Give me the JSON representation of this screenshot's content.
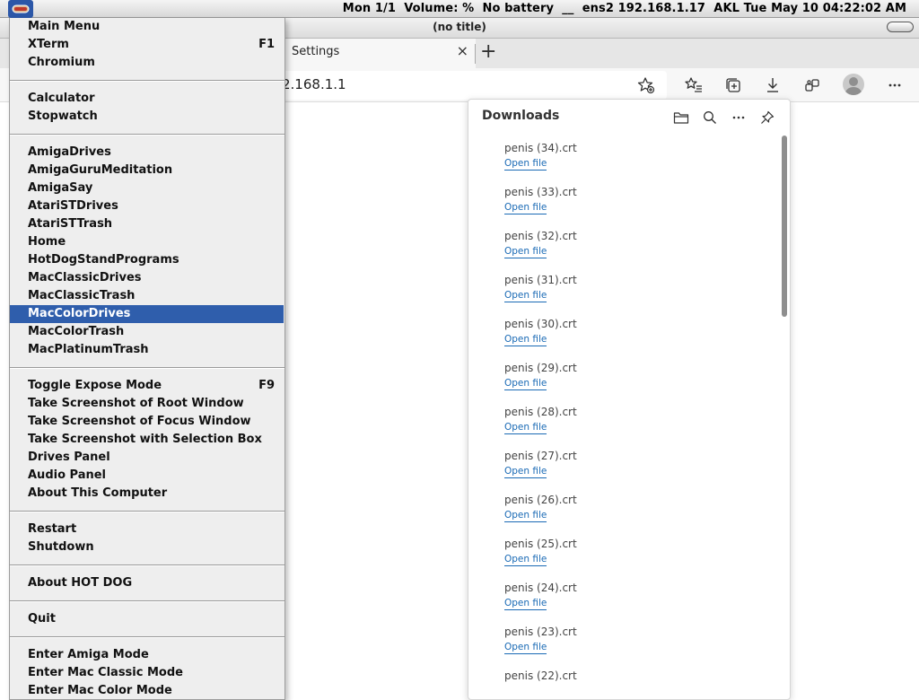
{
  "topbar": {
    "status": "Mon 1/1  Volume: %  No battery  __  ens2 192.168.1.17  AKL Tue May 10 04:22:02 AM"
  },
  "window": {
    "title": "(no title)"
  },
  "browser": {
    "tab": {
      "label": "Settings",
      "close": "×"
    },
    "new_tab": "+",
    "address": "2.168.1.1"
  },
  "downloads": {
    "title": "Downloads",
    "open_label": "Open file",
    "items": [
      {
        "name": "penis (34).crt",
        "action": "Open file"
      },
      {
        "name": "penis (33).crt",
        "action": "Open file"
      },
      {
        "name": "penis (32).crt",
        "action": "Open file"
      },
      {
        "name": "penis (31).crt",
        "action": "Open file"
      },
      {
        "name": "penis (30).crt",
        "action": "Open file"
      },
      {
        "name": "penis (29).crt",
        "action": "Open file"
      },
      {
        "name": "penis (28).crt",
        "action": "Open file"
      },
      {
        "name": "penis (27).crt",
        "action": "Open file"
      },
      {
        "name": "penis (26).crt",
        "action": "Open file"
      },
      {
        "name": "penis (25).crt",
        "action": "Open file"
      },
      {
        "name": "penis (24).crt",
        "action": "Open file"
      },
      {
        "name": "penis (23).crt",
        "action": "Open file"
      },
      {
        "name": "penis (22).crt",
        "action": ""
      }
    ]
  },
  "menu": {
    "groups": [
      [
        {
          "label": "Main Menu",
          "shortcut": ""
        },
        {
          "label": "XTerm",
          "shortcut": "F1"
        },
        {
          "label": "Chromium",
          "shortcut": ""
        }
      ],
      [
        {
          "label": "Calculator",
          "shortcut": ""
        },
        {
          "label": "Stopwatch",
          "shortcut": ""
        }
      ],
      [
        {
          "label": "AmigaDrives",
          "shortcut": ""
        },
        {
          "label": "AmigaGuruMeditation",
          "shortcut": ""
        },
        {
          "label": "AmigaSay",
          "shortcut": ""
        },
        {
          "label": "AtariSTDrives",
          "shortcut": ""
        },
        {
          "label": "AtariSTTrash",
          "shortcut": ""
        },
        {
          "label": "Home",
          "shortcut": ""
        },
        {
          "label": "HotDogStandPrograms",
          "shortcut": ""
        },
        {
          "label": "MacClassicDrives",
          "shortcut": ""
        },
        {
          "label": "MacClassicTrash",
          "shortcut": ""
        },
        {
          "label": "MacColorDrives",
          "shortcut": "",
          "selected": true
        },
        {
          "label": "MacColorTrash",
          "shortcut": ""
        },
        {
          "label": "MacPlatinumTrash",
          "shortcut": ""
        }
      ],
      [
        {
          "label": "Toggle Expose Mode",
          "shortcut": "F9"
        },
        {
          "label": "Take Screenshot of Root Window",
          "shortcut": ""
        },
        {
          "label": "Take Screenshot of Focus Window",
          "shortcut": ""
        },
        {
          "label": "Take Screenshot with Selection Box",
          "shortcut": ""
        },
        {
          "label": "Drives Panel",
          "shortcut": ""
        },
        {
          "label": "Audio Panel",
          "shortcut": ""
        },
        {
          "label": "About This Computer",
          "shortcut": ""
        }
      ],
      [
        {
          "label": "Restart",
          "shortcut": ""
        },
        {
          "label": "Shutdown",
          "shortcut": ""
        }
      ],
      [
        {
          "label": "About HOT DOG",
          "shortcut": ""
        }
      ],
      [
        {
          "label": "Quit",
          "shortcut": ""
        }
      ],
      [
        {
          "label": "Enter Amiga Mode",
          "shortcut": ""
        },
        {
          "label": "Enter Mac Classic Mode",
          "shortcut": ""
        },
        {
          "label": "Enter Mac Color Mode",
          "shortcut": ""
        }
      ]
    ]
  },
  "colors": {
    "menu_selection": "#2f5eac",
    "link": "#1a6ab5"
  }
}
